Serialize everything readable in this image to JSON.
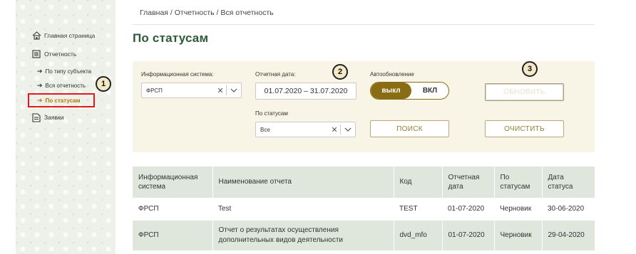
{
  "sidebar": {
    "home": "Главная страница",
    "reports": "Отчетность",
    "by_subject": "По типу субъекта",
    "all_reports": "Вся отчетность",
    "by_status": "По статусам",
    "requests": "Заявки"
  },
  "breadcrumb": "Главная  /  Отчетность  /  Вся отчетность",
  "page_title": "По статусам",
  "filters": {
    "info_system_label": "Информационная система:",
    "info_system_value": "ФРСП",
    "date_label": "Отчетная дата:",
    "date_value": "01.07.2020 – 31.07.2020",
    "auto_label": "Автообновление",
    "toggle_on": "выкл",
    "toggle_off": "ВКЛ",
    "refresh_button": "ОБНОВИТЬ",
    "status_label": "По статусам",
    "status_value": "Все",
    "search_button": "ПОИСК",
    "clear_button": "ОЧИСТИТЬ"
  },
  "callouts": [
    "1",
    "2",
    "3"
  ],
  "table": {
    "headers": [
      "Информационная система",
      "Наименование отчета",
      "Код",
      "Отчетная дата",
      "По статусам",
      "Дата статуса"
    ],
    "rows": [
      [
        "ФРСП",
        "Test",
        "TEST",
        "01-07-2020",
        "Черновик",
        "30-06-2020"
      ],
      [
        "ФРСП",
        "Отчет о результатах осуществления дополнительных видов деятельности",
        "dvd_mfo",
        "01-07-2020",
        "Черновик",
        "29-04-2020"
      ]
    ]
  },
  "colors": {
    "accent": "#8a6c14",
    "title": "#2e5a36",
    "highlight": "#e31a1a",
    "table_header": "#dfe6dc",
    "panel": "#f8f4e6"
  }
}
